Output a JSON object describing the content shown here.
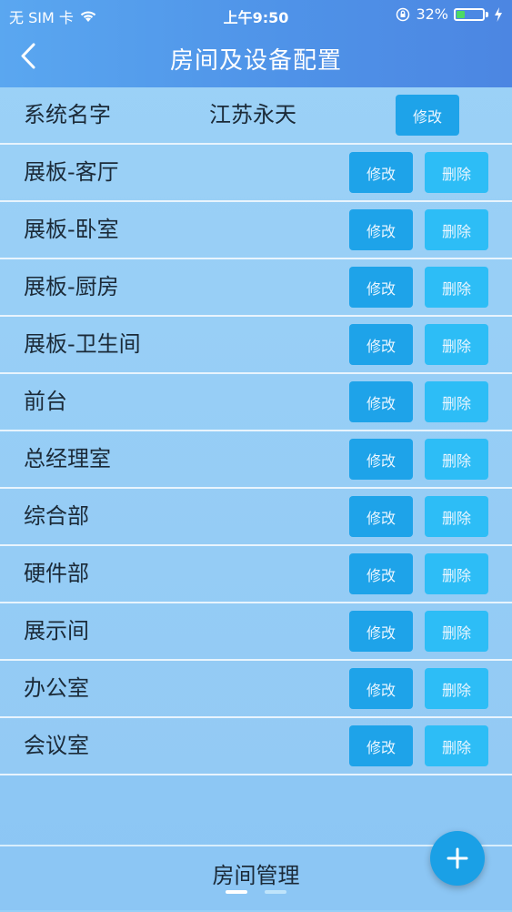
{
  "status": {
    "carrier": "无 SIM 卡",
    "time": "上午9:50",
    "battery_pct": "32%",
    "battery_level": 0.32
  },
  "nav": {
    "title": "房间及设备配置"
  },
  "system_row": {
    "label": "系统名字",
    "value": "江苏永天",
    "edit_label": "修改"
  },
  "rooms": [
    {
      "name": "展板-客厅",
      "edit": "修改",
      "delete": "删除"
    },
    {
      "name": "展板-卧室",
      "edit": "修改",
      "delete": "删除"
    },
    {
      "name": "展板-厨房",
      "edit": "修改",
      "delete": "删除"
    },
    {
      "name": "展板-卫生间",
      "edit": "修改",
      "delete": "删除"
    },
    {
      "name": "前台",
      "edit": "修改",
      "delete": "删除"
    },
    {
      "name": "总经理室",
      "edit": "修改",
      "delete": "删除"
    },
    {
      "name": "综合部",
      "edit": "修改",
      "delete": "删除"
    },
    {
      "name": "硬件部",
      "edit": "修改",
      "delete": "删除"
    },
    {
      "name": "展示间",
      "edit": "修改",
      "delete": "删除"
    },
    {
      "name": "办公室",
      "edit": "修改",
      "delete": "删除"
    },
    {
      "name": "会议室",
      "edit": "修改",
      "delete": "删除"
    }
  ],
  "bottom": {
    "label": "房间管理",
    "page_count": 2,
    "active_page": 1
  },
  "icons": {
    "back": "chevron-left-icon",
    "add": "plus-icon",
    "wifi": "wifi-icon",
    "lock": "orientation-lock-icon",
    "charging": "lightning-icon"
  },
  "colors": {
    "header": "#4f93e8",
    "edit_button": "#1ea3e9",
    "delete_button": "#2dbdf6",
    "fab": "#1aa0e6"
  }
}
